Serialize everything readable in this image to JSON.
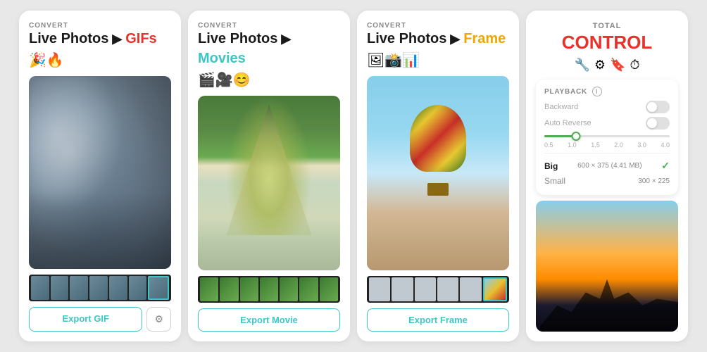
{
  "panels": [
    {
      "id": "panel1",
      "convert_label": "CONVERT",
      "title_black": "Live Photos",
      "arrow": "▶",
      "title_accent": "GIFs",
      "accent_class": "title-accent-red",
      "icons": "🎉🔥",
      "export_btn": "Export GIF",
      "has_gear": true,
      "gear_icon": "⚙",
      "filmstrip_type": "room"
    },
    {
      "id": "panel2",
      "convert_label": "CONVERT",
      "title_black": "Live Photos",
      "arrow": "▶",
      "title_accent": "Movies",
      "accent_class": "title-accent-cyan",
      "icons": "🎬🎥😊",
      "export_btn": "Export Movie",
      "has_gear": false,
      "filmstrip_type": "green"
    },
    {
      "id": "panel3",
      "convert_label": "CONVERT",
      "title_black": "Live Photos",
      "arrow": "▶",
      "title_accent": "Frame",
      "accent_class": "title-accent-orange",
      "icons": "🖼📸📊",
      "export_btn": "Export Frame",
      "has_gear": false,
      "filmstrip_type": "balloon"
    },
    {
      "id": "panel4",
      "total_label": "TOTAL",
      "control_title": "CONTROL",
      "icons": "🔧⚙🔖⏱",
      "playback_label": "PLAYBACK",
      "backward_label": "Backward",
      "auto_reverse_label": "Auto Reverse",
      "slider_ticks": [
        "0.5",
        "1.0",
        "1.5",
        "2.0",
        "3.0",
        "4.0"
      ],
      "size_big_label": "Big",
      "size_big_value": "600 × 375 (4.41 MB)",
      "size_small_label": "Small",
      "size_small_value": "300 × 225"
    }
  ]
}
